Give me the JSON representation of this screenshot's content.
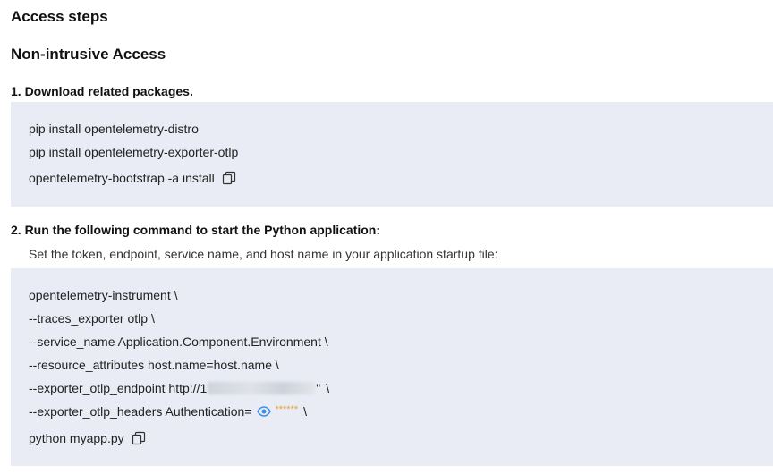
{
  "page": {
    "title": "Access steps",
    "subtitle": "Non-intrusive Access"
  },
  "step1": {
    "heading": "1. Download related packages.",
    "lines": [
      "pip install opentelemetry-distro",
      "pip install opentelemetry-exporter-otlp",
      "opentelemetry-bootstrap -a install"
    ]
  },
  "step2": {
    "heading": "2. Run the following command to start the Python application:",
    "description": "Set the token, endpoint, service name, and host name in your application startup file:",
    "lines": [
      "opentelemetry-instrument \\",
      "--traces_exporter otlp \\",
      "--service_name Application.Component.Environment \\",
      "--resource_attributes host.name=host.name \\",
      "--exporter_otlp_endpoint http://1",
      "--exporter_otlp_headers Authentication=",
      "python myapp.py"
    ],
    "endpoint_suffix": "\"",
    "line_continuation": "\\",
    "masked_token": "******"
  },
  "icons": {
    "copy": "copy-icon",
    "reveal": "eye-icon"
  },
  "colors": {
    "code_background": "#e9ecf5",
    "eye_icon": "#3b8ee8",
    "mask_stars": "#e6a23c"
  }
}
